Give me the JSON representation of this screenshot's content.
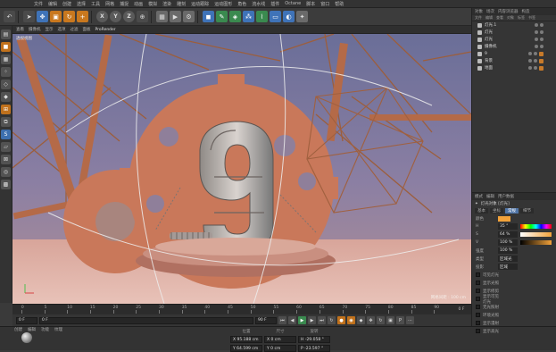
{
  "menubar": {
    "items": [
      "文件",
      "编辑",
      "创建",
      "选择",
      "工具",
      "网格",
      "捕捉",
      "动画",
      "模拟",
      "渲染",
      "雕刻",
      "运动跟踪",
      "运动图形",
      "角色",
      "流水线",
      "插件",
      "Octane",
      "脚本",
      "窗口",
      "帮助"
    ]
  },
  "toolbar": {
    "axis_labels": [
      "X",
      "Y",
      "Z"
    ]
  },
  "viewport": {
    "menu": [
      "查看",
      "摄像机",
      "显示",
      "选项",
      "过滤",
      "面板",
      "ProRender"
    ],
    "label": "透视视图",
    "corner_text": "网格间距 : 100 cm",
    "scene_text": "9"
  },
  "timeline": {
    "ticks": [
      "0",
      "5",
      "10",
      "15",
      "20",
      "25",
      "30",
      "35",
      "40",
      "45",
      "50",
      "55",
      "60",
      "65",
      "70",
      "75",
      "80",
      "85",
      "90"
    ],
    "end_label": "0 F"
  },
  "transport": {
    "start_frame": "0 F",
    "current_frame": "0 F",
    "end_frame": "90 F",
    "max_frame": "90 F"
  },
  "material": {
    "menu": [
      "创建",
      "编辑",
      "功能",
      "纹理"
    ]
  },
  "coordinates": {
    "headers": [
      "位置",
      "尺寸",
      "旋转"
    ],
    "fields": [
      "X  95.188 cm",
      "X  0 cm",
      "H  -29.058 °",
      "Y  64.599 cm",
      "Y  0 cm",
      "P  -23.597 °"
    ]
  },
  "object_panel": {
    "tabs": [
      "对象",
      "场次",
      "内容浏览器",
      "构造"
    ],
    "menu": [
      "文件",
      "编辑",
      "查看",
      "对象",
      "标签",
      "书签"
    ],
    "objects": [
      {
        "name": "灯光.1"
      },
      {
        "name": "灯光"
      },
      {
        "name": "灯光"
      },
      {
        "name": "摄像机"
      },
      {
        "name": "9"
      },
      {
        "name": "背景"
      },
      {
        "name": "地面"
      }
    ]
  },
  "attributes": {
    "tabs": [
      "模式",
      "编辑",
      "用户数据"
    ],
    "title": "灯光对象 [灯光]",
    "subtabs": [
      "基本",
      "坐标",
      "常规",
      "细节"
    ],
    "rows": [
      {
        "label": "颜色",
        "value": ""
      },
      {
        "label": "H",
        "value": "35 °"
      },
      {
        "label": "S",
        "value": "64 %"
      },
      {
        "label": "V",
        "value": "100 %"
      },
      {
        "label": "强度",
        "value": "100 %"
      },
      {
        "label": "类型",
        "value": "区域光"
      },
      {
        "label": "投影",
        "value": "区域"
      }
    ],
    "checks": [
      "可见灯光",
      "显示光照",
      "显示修剪",
      "显示可见灯光",
      "无光照射",
      "环境光照",
      "显示漫射",
      "显示高光"
    ]
  },
  "colors": {
    "accent_orange": "#c9781e",
    "accent_blue": "#3f73b8",
    "swatch_color": "#f2a23a"
  }
}
